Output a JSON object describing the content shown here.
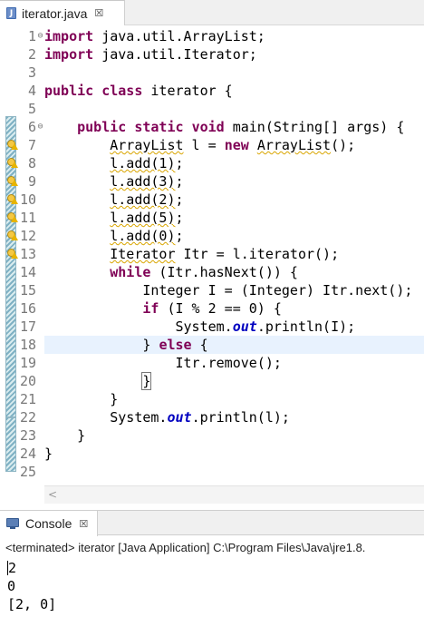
{
  "editor_tab": {
    "label": "iterator.java",
    "close": "☒",
    "icon": "java-file-icon"
  },
  "code_lines": [
    {
      "num": "1",
      "fold": "⊖",
      "html": "<span class=\"kw\">import</span> java.util.ArrayList;"
    },
    {
      "num": "2",
      "fold": "",
      "html": "<span class=\"kw\">import</span> java.util.Iterator;"
    },
    {
      "num": "3",
      "fold": "",
      "html": ""
    },
    {
      "num": "4",
      "fold": "",
      "html": "<span class=\"kw\">public</span> <span class=\"kw\">class</span> iterator {"
    },
    {
      "num": "5",
      "fold": "",
      "html": ""
    },
    {
      "num": "6",
      "fold": "⊖",
      "html": "    <span class=\"kw\">public</span> <span class=\"kw\">static</span> <span class=\"kw\">void</span> main(String[] args) {"
    },
    {
      "num": "7",
      "fold": "",
      "warn": true,
      "html": "        <span class=\"wv\">ArrayList</span> l = <span class=\"kw\">new</span> <span class=\"wv\">ArrayList</span>();"
    },
    {
      "num": "8",
      "fold": "",
      "warn": true,
      "html": "        <span class=\"wv\">l.add(1)</span>;"
    },
    {
      "num": "9",
      "fold": "",
      "warn": true,
      "html": "        <span class=\"wv\">l.add(3)</span>;"
    },
    {
      "num": "10",
      "fold": "",
      "warn": true,
      "html": "        <span class=\"wv\">l.add(2)</span>;"
    },
    {
      "num": "11",
      "fold": "",
      "warn": true,
      "html": "        <span class=\"wv\">l.add(5)</span>;"
    },
    {
      "num": "12",
      "fold": "",
      "warn": true,
      "html": "        <span class=\"wv\">l.add(0)</span>;"
    },
    {
      "num": "13",
      "fold": "",
      "warn": true,
      "html": "        <span class=\"wv\">Iterator</span> Itr = l.iterator();"
    },
    {
      "num": "14",
      "fold": "",
      "html": "        <span class=\"kw\">while</span> (Itr.hasNext()) {"
    },
    {
      "num": "15",
      "fold": "",
      "html": "            Integer I = (Integer) Itr.next();"
    },
    {
      "num": "16",
      "fold": "",
      "html": "            <span class=\"kw\">if</span> (I % 2 == 0) {"
    },
    {
      "num": "17",
      "fold": "",
      "html": "                System.<span class=\"st\">out</span>.println(I);"
    },
    {
      "num": "18",
      "fold": "",
      "current": true,
      "html": "            } <span class=\"kw\">else</span> {"
    },
    {
      "num": "19",
      "fold": "",
      "html": "                Itr.remove();"
    },
    {
      "num": "20",
      "fold": "",
      "html": "            <span class=\"bk\">}</span>"
    },
    {
      "num": "21",
      "fold": "",
      "html": "        }"
    },
    {
      "num": "22",
      "fold": "",
      "html": "        System.<span class=\"st\">out</span>.println(l);"
    },
    {
      "num": "23",
      "fold": "",
      "html": "    }"
    },
    {
      "num": "24",
      "fold": "",
      "html": "}"
    },
    {
      "num": "25",
      "fold": "",
      "html": ""
    }
  ],
  "hscroll": {
    "left_arrow": "<"
  },
  "console": {
    "tab_label": "Console",
    "close": "☒",
    "icon": "console-icon",
    "status": "<terminated> iterator [Java Application] C:\\Program Files\\Java\\jre1.8.",
    "output": [
      "2",
      "0",
      "[2, 0]"
    ]
  }
}
